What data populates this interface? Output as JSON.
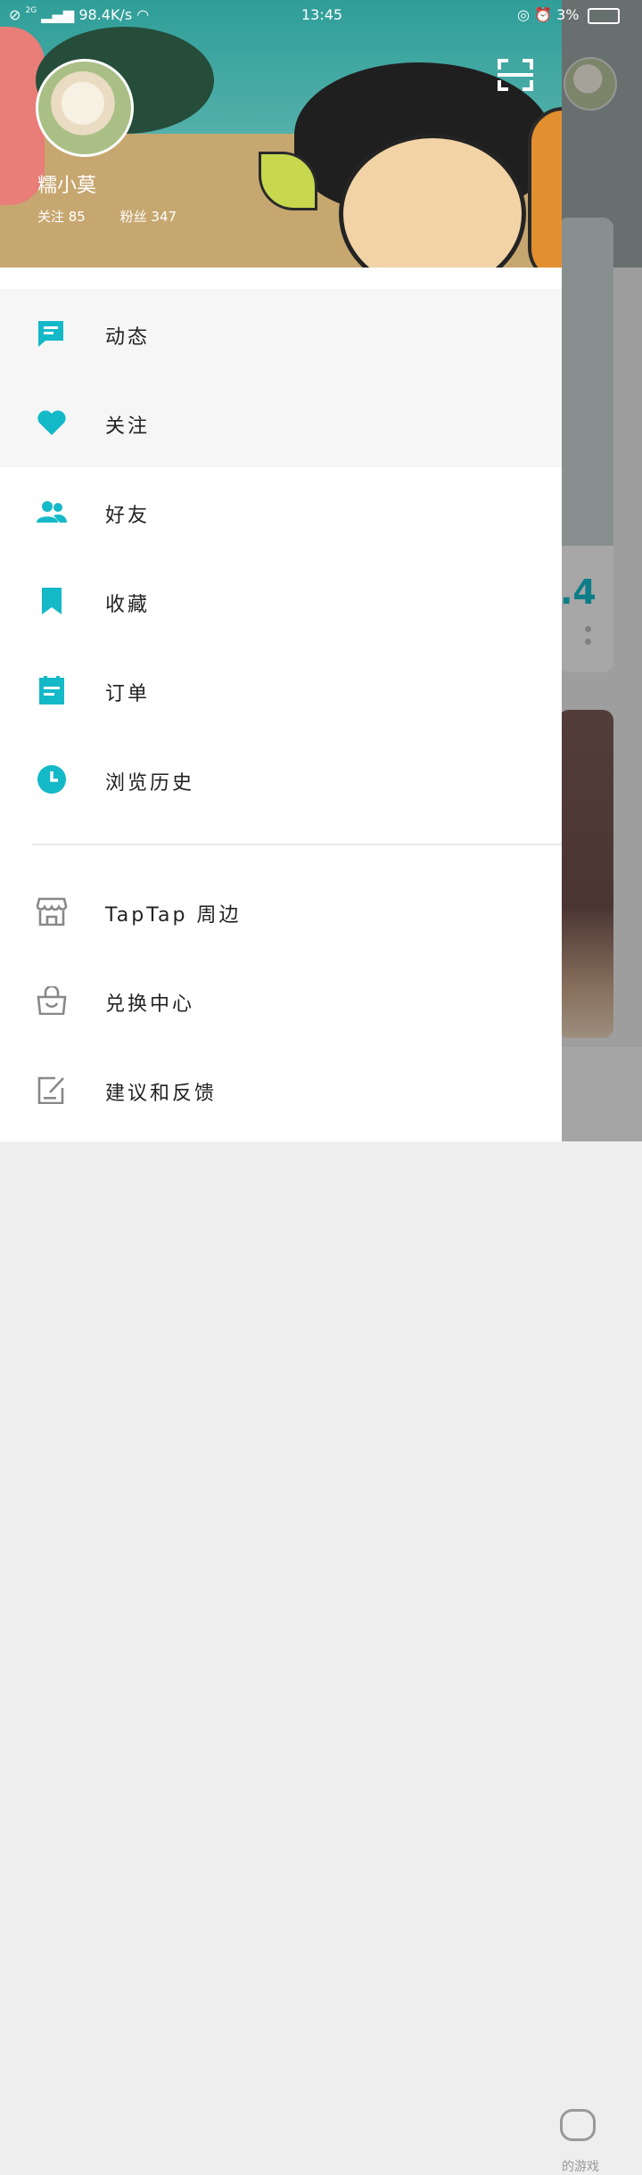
{
  "status_bar": {
    "network_speed": "98.4K/s",
    "signal_label": "2G",
    "time": "13:45",
    "battery": "3%"
  },
  "profile": {
    "username": "糯小莫",
    "following_label": "关注 85",
    "followers_label": "粉丝 347"
  },
  "menu_primary": [
    {
      "label": "动态",
      "icon": "chat-icon"
    },
    {
      "label": "关注",
      "icon": "heart-icon"
    },
    {
      "label": "好友",
      "icon": "people-icon"
    },
    {
      "label": "收藏",
      "icon": "bookmark-icon"
    },
    {
      "label": "订单",
      "icon": "clipboard-icon"
    },
    {
      "label": "浏览历史",
      "icon": "clock-icon"
    }
  ],
  "menu_secondary": [
    {
      "label": "TapTap 周边",
      "icon": "store-icon"
    },
    {
      "label": "兑换中心",
      "icon": "shopping-bag-icon"
    },
    {
      "label": "建议和反馈",
      "icon": "edit-icon"
    }
  ],
  "background": {
    "score_fragment": ".4",
    "tab_label_fragment": "的游戏"
  },
  "colors": {
    "accent": "#14b9c8",
    "icon_gray": "#888888",
    "text": "#222222"
  }
}
